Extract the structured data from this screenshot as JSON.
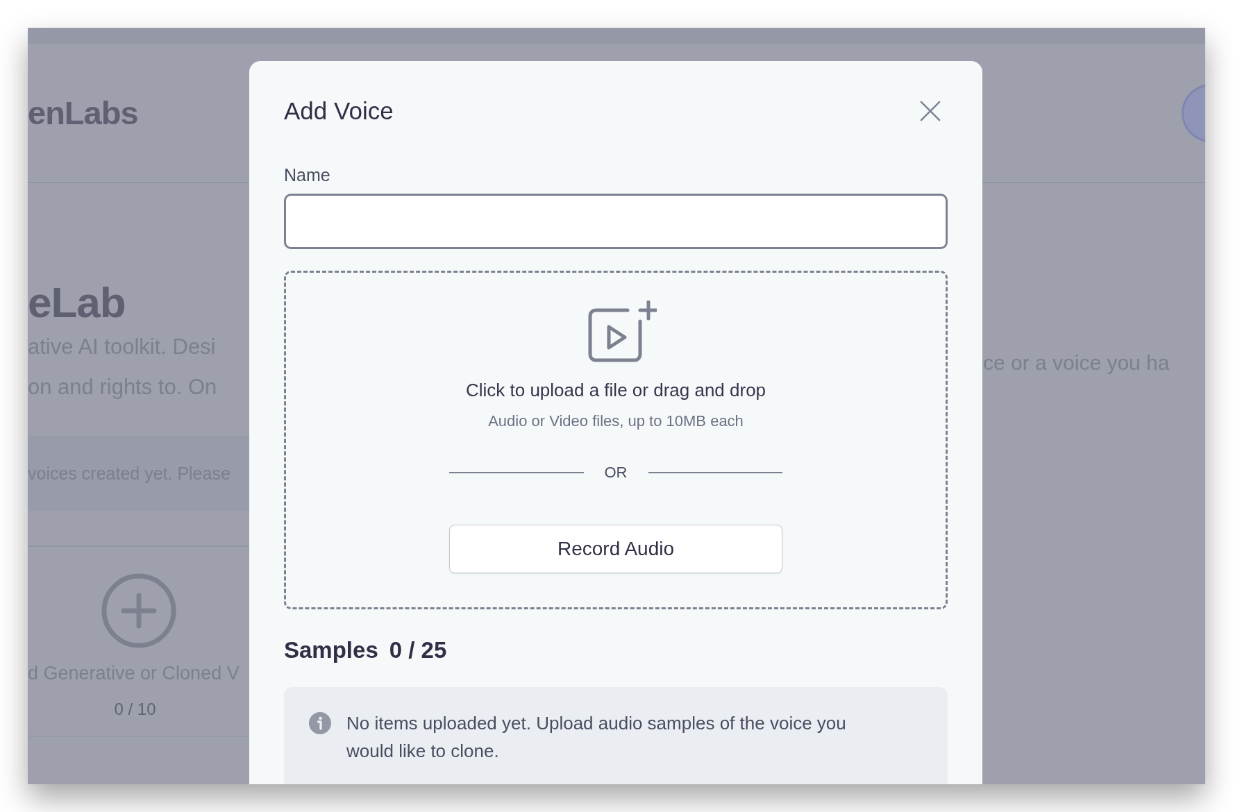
{
  "background_page": {
    "logo": "enLabs",
    "heading": "eLab",
    "description_lines": [
      "ative AI toolkit. Desi",
      "on and rights to. On"
    ],
    "description_right": "ce or a voice you ha",
    "notice": "voices created yet. Please",
    "add_card": {
      "label": "d Generative or Cloned V",
      "count": "0 / 10"
    }
  },
  "dialog": {
    "title": "Add Voice",
    "name_field": {
      "label": "Name"
    },
    "upload": {
      "title": "Click to upload a file or drag and drop",
      "hint": "Audio or Video files, up to 10MB each",
      "divider": "OR",
      "record_button": "Record Audio"
    },
    "samples": {
      "label": "Samples",
      "count": "0 / 25"
    },
    "info": "No items uploaded yet. Upload audio samples of the voice you would like to clone."
  }
}
